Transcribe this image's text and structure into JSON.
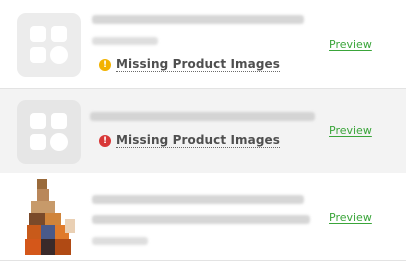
{
  "rows": [
    {
      "warning": {
        "icon": "warning-icon",
        "label": "Missing Product Images",
        "color": "#f2b200"
      },
      "preview_label": "Preview"
    },
    {
      "warning": {
        "icon": "error-icon",
        "label": "Missing Product Images",
        "color": "#d83737"
      },
      "preview_label": "Preview"
    },
    {
      "preview_label": "Preview"
    }
  ],
  "colors": {
    "link": "#3aa53a",
    "selected_row": "#f3f3f3"
  }
}
